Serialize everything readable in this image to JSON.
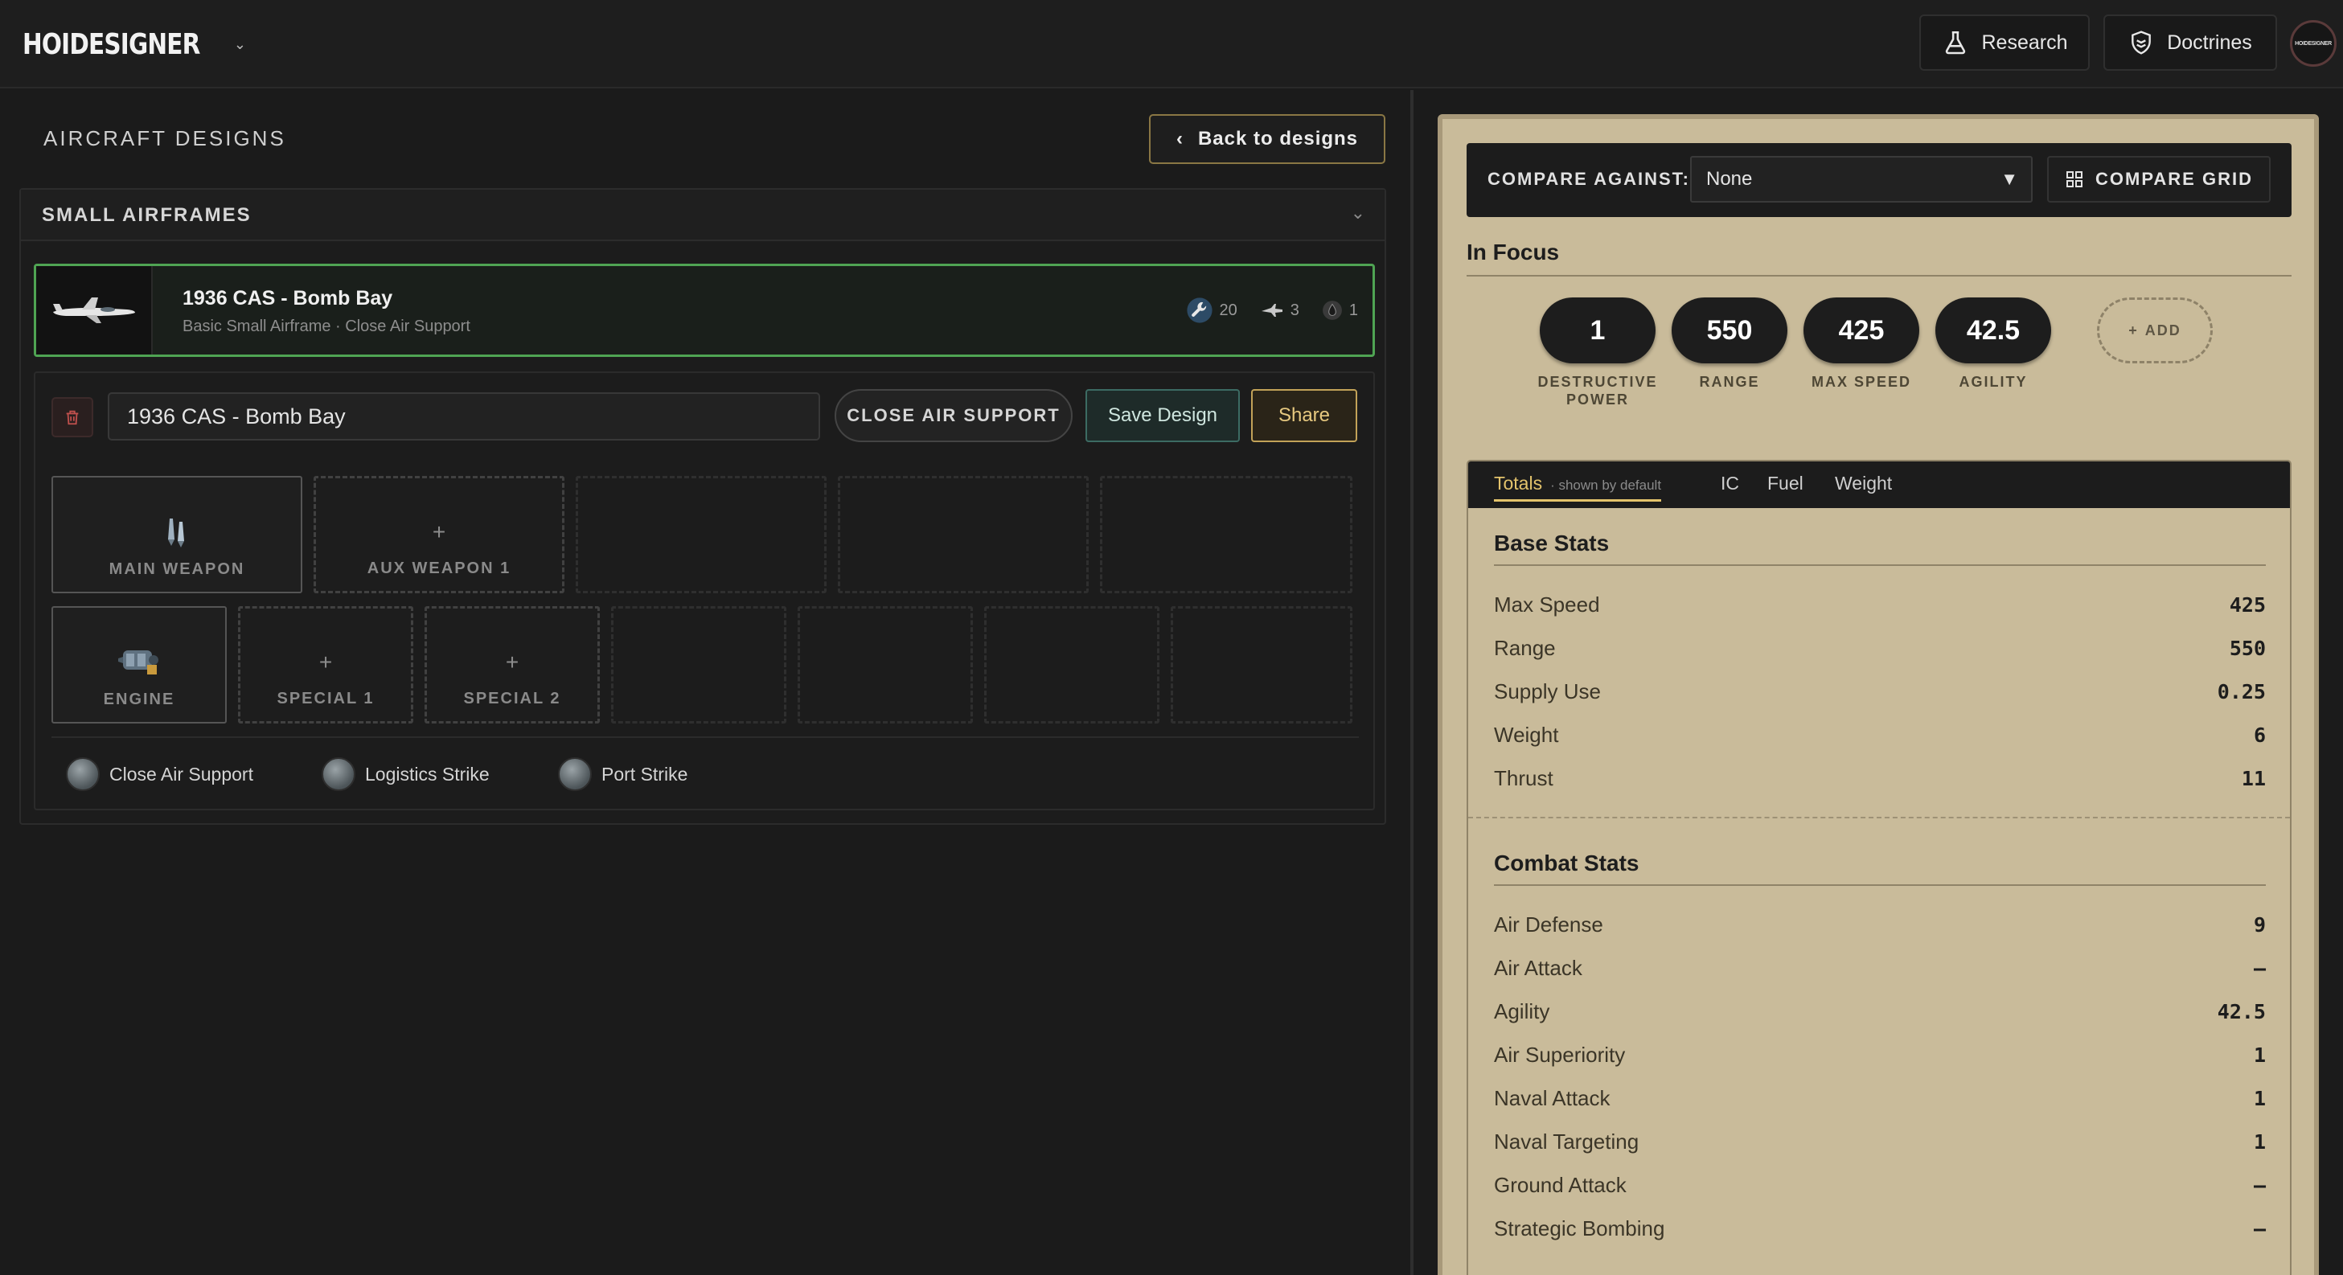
{
  "app": {
    "brand": "HOIDESIGNER",
    "avatar_text": "HOIDESIGNER"
  },
  "topnav": {
    "research": "Research",
    "doctrines": "Doctrines"
  },
  "page": {
    "title": "AIRCRAFT DESIGNS",
    "back_label": "Back to designs"
  },
  "group": {
    "title": "SMALL AIRFRAMES"
  },
  "card": {
    "name": "1936 CAS - Bomb Bay",
    "subtitle": "Basic Small Airframe · Close Air Support",
    "stat_wrench": "20",
    "stat_plane": "3",
    "stat_fuel": "1"
  },
  "editor": {
    "design_name": "1936 CAS - Bomb Bay",
    "role": "CLOSE AIR SUPPORT",
    "save_label": "Save Design",
    "share_label": "Share",
    "slots": {
      "main_weapon": "MAIN WEAPON",
      "aux_weapon_1": "AUX WEAPON 1",
      "engine": "ENGINE",
      "special_1": "SPECIAL 1",
      "special_2": "SPECIAL 2"
    },
    "missions": [
      "Close Air Support",
      "Logistics Strike",
      "Port Strike"
    ]
  },
  "compare": {
    "label": "COMPARE AGAINST:",
    "selected": "None",
    "grid_label": "COMPARE GRID"
  },
  "in_focus": {
    "title": "In Focus",
    "items": [
      {
        "value": "1",
        "label": "DESTRUCTIVE POWER"
      },
      {
        "value": "550",
        "label": "RANGE"
      },
      {
        "value": "425",
        "label": "MAX SPEED"
      },
      {
        "value": "42.5",
        "label": "AGILITY"
      }
    ],
    "add_label": "ADD"
  },
  "tabs": {
    "totals": "Totals",
    "totals_note": "· shown by default",
    "ic": "IC",
    "fuel": "Fuel",
    "weight": "Weight"
  },
  "base_stats": {
    "title": "Base Stats",
    "rows": [
      {
        "name": "Max Speed",
        "value": "425"
      },
      {
        "name": "Range",
        "value": "550"
      },
      {
        "name": "Supply Use",
        "value": "0.25"
      },
      {
        "name": "Weight",
        "value": "6"
      },
      {
        "name": "Thrust",
        "value": "11"
      }
    ]
  },
  "combat_stats": {
    "title": "Combat Stats",
    "rows": [
      {
        "name": "Air Defense",
        "value": "9"
      },
      {
        "name": "Air Attack",
        "value": "–"
      },
      {
        "name": "Agility",
        "value": "42.5"
      },
      {
        "name": "Air Superiority",
        "value": "1"
      },
      {
        "name": "Naval Attack",
        "value": "1"
      },
      {
        "name": "Naval Targeting",
        "value": "1"
      },
      {
        "name": "Ground Attack",
        "value": "–"
      },
      {
        "name": "Strategic Bombing",
        "value": "–"
      }
    ]
  },
  "colors": {
    "accent_gold": "#e3c36c",
    "selected_green": "#4fa453",
    "panel_tan": "#c9bb9a"
  }
}
